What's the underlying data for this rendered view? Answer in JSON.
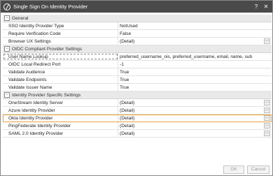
{
  "window": {
    "title": "Single Sign On Identity Provider",
    "help_label": "?",
    "close_label": "✕"
  },
  "sections": [
    {
      "title": "General",
      "toggle": "−",
      "rows": [
        {
          "label": "SSO Identity Provider Type",
          "value": "NotUsed",
          "ellipsis": false
        },
        {
          "label": "Require Verification Code",
          "value": "False",
          "ellipsis": false
        },
        {
          "label": "Browser UX Settings",
          "value": "(Detail)",
          "ellipsis": true
        }
      ]
    },
    {
      "title": "OIDC Compliant Provider Settings",
      "toggle": "−",
      "rows": [
        {
          "label": "User Name Lookup",
          "value": "preferred_username_ois, preferred_username, email, name, sub",
          "ellipsis": false
        },
        {
          "label": "OIDC Local Redirect Port",
          "value": "-1",
          "ellipsis": false
        },
        {
          "label": "Validate Audience",
          "value": "True",
          "ellipsis": false
        },
        {
          "label": "Validate Endpoints",
          "value": "True",
          "ellipsis": false
        },
        {
          "label": "Validate Issuer Name",
          "value": "True",
          "ellipsis": false
        }
      ]
    },
    {
      "title": "Identity Provider Specific Settings",
      "toggle": "−",
      "rows": [
        {
          "label": "OneStream Identity Server",
          "value": "(Detail)",
          "ellipsis": true
        },
        {
          "label": "Azure Identity Provider",
          "value": "(Detail)",
          "ellipsis": true
        },
        {
          "label": "Okta Identity Provider",
          "value": "(Detail)",
          "ellipsis": true
        },
        {
          "label": "PingFederate Identity Provider",
          "value": "(Detail)",
          "ellipsis": true
        },
        {
          "label": "SAML 2.0 Identity Provider",
          "value": "(Detail)",
          "ellipsis": true
        }
      ]
    }
  ],
  "ellipsis_label": "...",
  "footer": {
    "ok_label": "OK",
    "cancel_label": "Cancel",
    "grip_label": "⋰"
  }
}
